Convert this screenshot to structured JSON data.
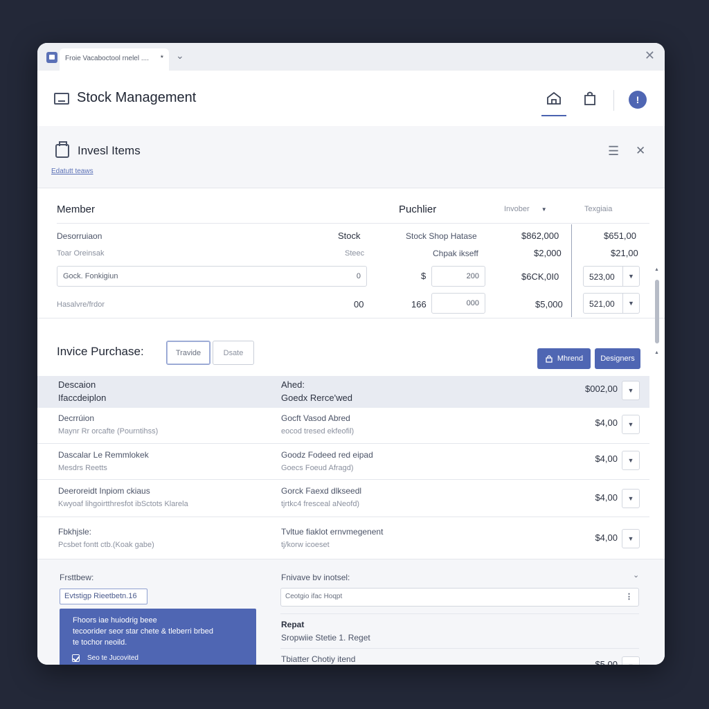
{
  "window": {
    "tab_title": "Froie Vacaboctool rnelel ....",
    "tab_dirty": "*"
  },
  "header": {
    "title": "Stock Management",
    "alert_glyph": "!"
  },
  "section": {
    "title": "Invesl Items",
    "link": "Edatutt teaws"
  },
  "stock": {
    "member_label": "Member",
    "puchlier_label": "Puchlier",
    "invober_label": "Invober",
    "texgiaia_label": "Texgiaia",
    "rows": {
      "r1": {
        "desc": "Desorruiaon",
        "stock": "Stock",
        "shop": "Stock Shop Hatase",
        "price": "$862,000",
        "total": "$651,00"
      },
      "r2": {
        "desc": "Toar Oreinsak",
        "stock": "Steec",
        "shop": "Chpak ikseff",
        "price": "$2,000",
        "total": "$21,00"
      },
      "r3": {
        "field": "Gock. Fonkigiun",
        "field_value": "0",
        "currency": "$",
        "qty": "200",
        "price": "$6CK,0I0",
        "select": "523,00"
      },
      "r4": {
        "desc": "Hasalvre/frdor",
        "stock": "00",
        "shop": "166",
        "qty": "000",
        "price": "$5,000",
        "select": "521,00"
      }
    }
  },
  "invoice": {
    "title": "Invice Purchase:",
    "btn_travide": "Travide",
    "btn_dsate": "Dsate",
    "btn_mhrend": "Mhrend",
    "btn_designers": "Designers",
    "header": {
      "desc_title": "Descaion",
      "desc_sub": "Ifaccdeiplon",
      "ahed_title": "Ahed:",
      "ahed_sub": "Goedx Rerce'wed",
      "amount": "$002,00"
    },
    "rows": [
      {
        "title": "Decrrúion",
        "sub": "Maynr Rr orcafte (Pourntihss)",
        "status": "Gocft Vasod Abred",
        "status_sub": "eocod tresed ekfeofil)",
        "amount": "$4,00"
      },
      {
        "title": "Dascalar Le Remmlokek",
        "sub": "Mesdrs Reetts",
        "status": "Goodz Fodeed red eipad",
        "status_sub": "Goecs Foeud Afragd)",
        "amount": "$4,00"
      },
      {
        "title": "Deeroreidt Inpiom ckiaus",
        "sub": "Kwyoaf lihgoirtthresfot ibSctots Klarela",
        "status": "Gorck Faexd dlkseedl",
        "status_sub": "tjrtkc4 fresceal aNeofd)",
        "amount": "$4,00"
      },
      {
        "title": "Fbkhjsle:",
        "sub": "Pcsbet fontt ctb.(Koak gabe)",
        "status": "Tvltue fiaklot ernvmegenent",
        "status_sub": "tj/korw icoeset",
        "amount": "$4,00"
      }
    ]
  },
  "bottom": {
    "left_label": "Frsttbew:",
    "filter_button": "Evtstigp Rieetbetn.16",
    "card_line1": "Fhoors iae huiodrig beee",
    "card_line2": "tecoorider seor star chete & tleberri brbed",
    "card_line3": "te tochor neoild.",
    "card_check": "Seo te Jucovited",
    "right_label": "Fnivave bv inotsel:",
    "search_placeholder": "Ceotgio ifac Hoqpt",
    "repat_title": "Repat",
    "repat_sub": "Sropwiie Stetie 1. Reget",
    "last_row": "Tbiatter Chotiy itend",
    "last_amount": "$5,00"
  },
  "colors": {
    "accent": "#4f66b3",
    "background": "#232838"
  }
}
